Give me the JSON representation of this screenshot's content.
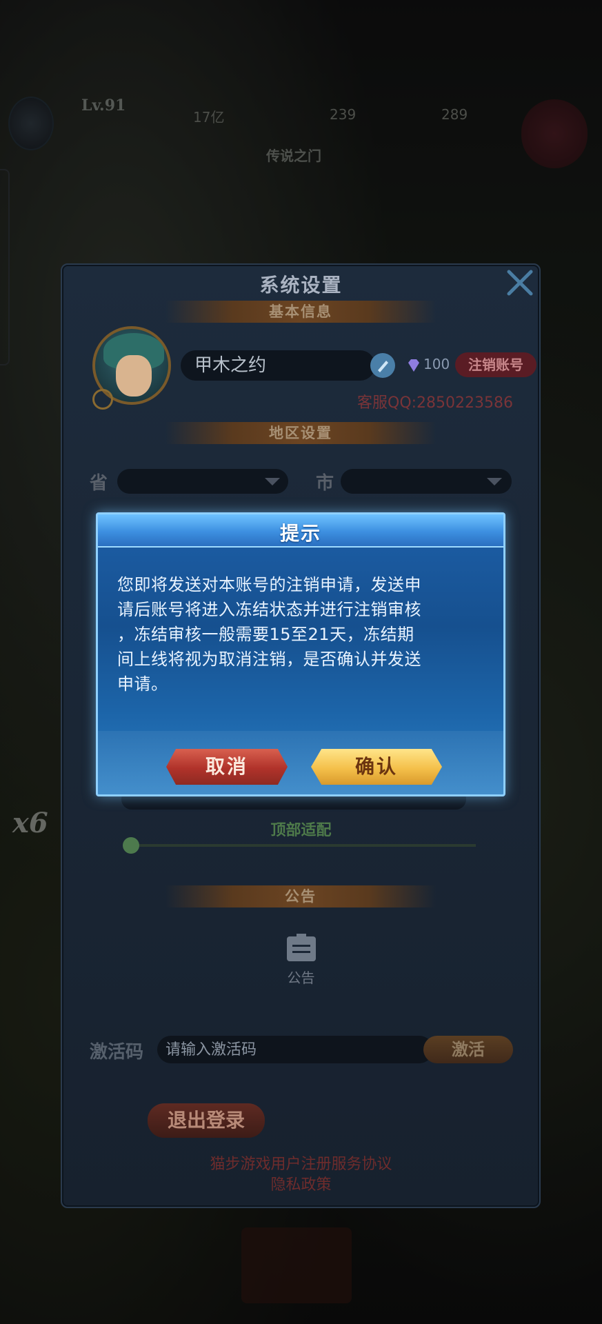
{
  "background": {
    "player_level": "Lv.91",
    "resource_1": "17亿",
    "resource_2": "239",
    "resource_3": "289",
    "gate_label": "传说之门",
    "side_stat": "x6"
  },
  "settings": {
    "title": "系统设置",
    "basic_info_label": "基本信息",
    "player_name": "甲木之约",
    "gem_count": "100",
    "cancel_account_label": "注销账号",
    "support_qq": "客服QQ:2850223586",
    "region_label": "地区设置",
    "province_label": "省",
    "city_label": "市",
    "top_adapt_label": "顶部适配",
    "slider_value": "0",
    "notice_section_label": "公告",
    "notice_label": "公告",
    "activation_code_label": "激活码",
    "activation_code_placeholder": "请输入激活码",
    "activate_button": "激活",
    "logout_button": "退出登录",
    "user_agreement_link": "猫步游戏用户注册服务协议",
    "privacy_policy_link": "隐私政策"
  },
  "dialog": {
    "title": "提示",
    "message_lines": [
      "您即将发送对本账号的注销申请，发送申",
      "请后账号将进入冻结状态并进行注销审核",
      "，冻结审核一般需要15至21天，冻结期",
      "间上线将视为取消注销，是否确认并发送",
      "申请。"
    ],
    "cancel_button": "取消",
    "confirm_button": "确认"
  },
  "colors": {
    "dialog_blue": "#1d5fa8",
    "confirm_gold": "#f4c04a",
    "cancel_red": "#b0322a"
  }
}
